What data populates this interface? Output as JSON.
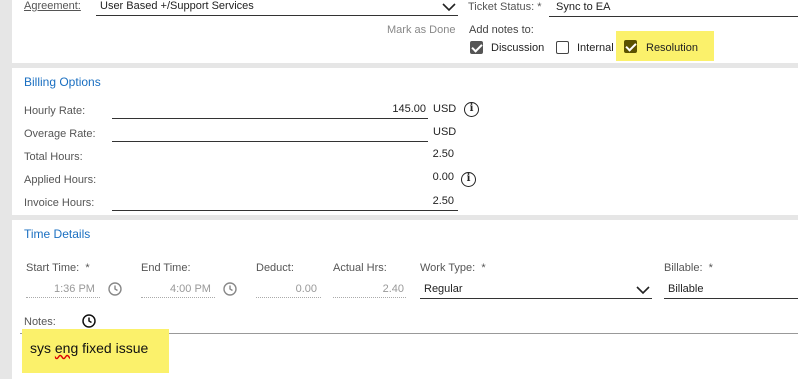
{
  "top": {
    "agreement_label": "Agreement:",
    "agreement_value": "User Based +/Support Services",
    "ticket_status_label": "Ticket Status:",
    "ticket_status_req": "*",
    "ticket_status_value": "Sync to EA",
    "mark_as_done": "Mark as Done",
    "add_notes_label": "Add notes to:",
    "notes_options": [
      {
        "label": "Discussion",
        "checked": true
      },
      {
        "label": "Internal",
        "checked": false
      },
      {
        "label": "Resolution",
        "checked": true
      }
    ]
  },
  "billing": {
    "title": "Billing Options",
    "hourly_rate_label": "Hourly Rate:",
    "hourly_rate_value": "145.00",
    "hourly_rate_unit": "USD",
    "overage_rate_label": "Overage Rate:",
    "overage_rate_value": "",
    "overage_rate_unit": "USD",
    "total_hours_label": "Total Hours:",
    "total_hours_value": "2.50",
    "applied_hours_label": "Applied Hours:",
    "applied_hours_value": "0.00",
    "invoice_hours_label": "Invoice Hours:",
    "invoice_hours_value": "2.50"
  },
  "time": {
    "title": "Time Details",
    "start_time_label": "Start Time:",
    "start_time_value": "1:36 PM",
    "end_time_label": "End Time:",
    "end_time_value": "4:00 PM",
    "deduct_label": "Deduct:",
    "deduct_value": "0.00",
    "actual_hrs_label": "Actual Hrs:",
    "actual_hrs_value": "2.40",
    "work_type_label": "Work Type:",
    "work_type_value": "Regular",
    "billable_label": "Billable:",
    "billable_value": "Billable",
    "required_mark": "*",
    "notes_label": "Notes:",
    "notes_text_before": "sys ",
    "notes_text_misspelled": "eng",
    "notes_text_after": " fixed issue"
  },
  "colors": {
    "highlight": "#fbf16b",
    "section_title": "#1a6fc1"
  }
}
